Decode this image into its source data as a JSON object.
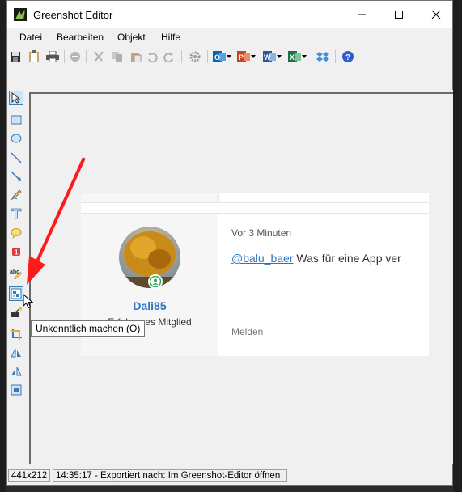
{
  "window": {
    "title": "Greenshot Editor"
  },
  "menu": [
    "Datei",
    "Bearbeiten",
    "Objekt",
    "Hilfe"
  ],
  "toolbar_icons": [
    "save-icon",
    "clipboard-icon",
    "print-icon",
    "delete-icon",
    "cut-icon",
    "copy-icon",
    "paste-icon",
    "undo-icon",
    "redo-icon",
    "settings-icon",
    "outlook-icon",
    "powerpoint-icon",
    "word-icon",
    "excel-icon",
    "dropbox-icon",
    "help-icon"
  ],
  "tools": [
    "select",
    "rectangle",
    "ellipse",
    "line",
    "arrow",
    "freehand",
    "text",
    "speechbubble",
    "counter",
    "highlight",
    "obfuscate",
    "effects",
    "crop",
    "rotate-cw",
    "rotate-ccw",
    "resize"
  ],
  "tooltip": "Unkenntlich machen (O)",
  "post": {
    "username": "Dali85",
    "role": "Erfahrenes Mitglied",
    "time": "Vor 3 Minuten",
    "mention": "@balu_baer",
    "message": " Was für eine App ver",
    "report": "Melden"
  },
  "status": {
    "size": "441x212",
    "message": "14:35:17 - Exportiert nach: Im Greenshot-Editor öffnen"
  },
  "colors": {
    "link": "#2a74c5",
    "annotation_arrow": "#ff1a1a"
  }
}
